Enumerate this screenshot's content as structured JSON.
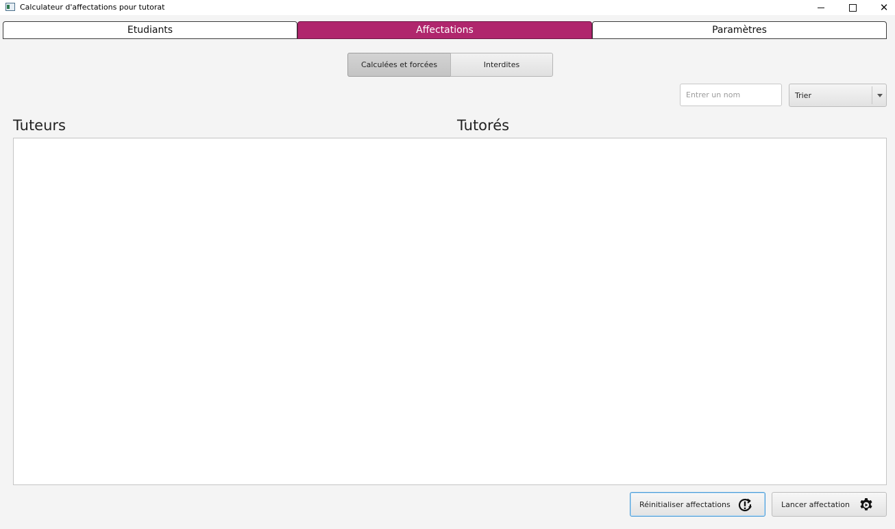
{
  "window": {
    "title": "Calculateur d'affectations pour tutorat",
    "close_glyph": "✕"
  },
  "tabs": [
    {
      "label": "Etudiants",
      "active": false
    },
    {
      "label": "Affectations",
      "active": true
    },
    {
      "label": "Paramètres",
      "active": false
    }
  ],
  "subtabs": [
    {
      "label": "Calculées et forcées",
      "selected": true
    },
    {
      "label": "Interdites",
      "selected": false
    }
  ],
  "search": {
    "placeholder": "Entrer un nom",
    "value": ""
  },
  "sort": {
    "label": "Trier"
  },
  "columns": {
    "tuteurs": "Tuteurs",
    "tutores": "Tutorés"
  },
  "buttons": {
    "reset": {
      "label": "Réinitialiser affectations",
      "icon": "reset-alert-icon"
    },
    "launch": {
      "label": "Lancer affectation",
      "icon": "gear-play-icon"
    }
  },
  "colors": {
    "accent": "#b0266d",
    "focus": "#4a9bd6"
  }
}
